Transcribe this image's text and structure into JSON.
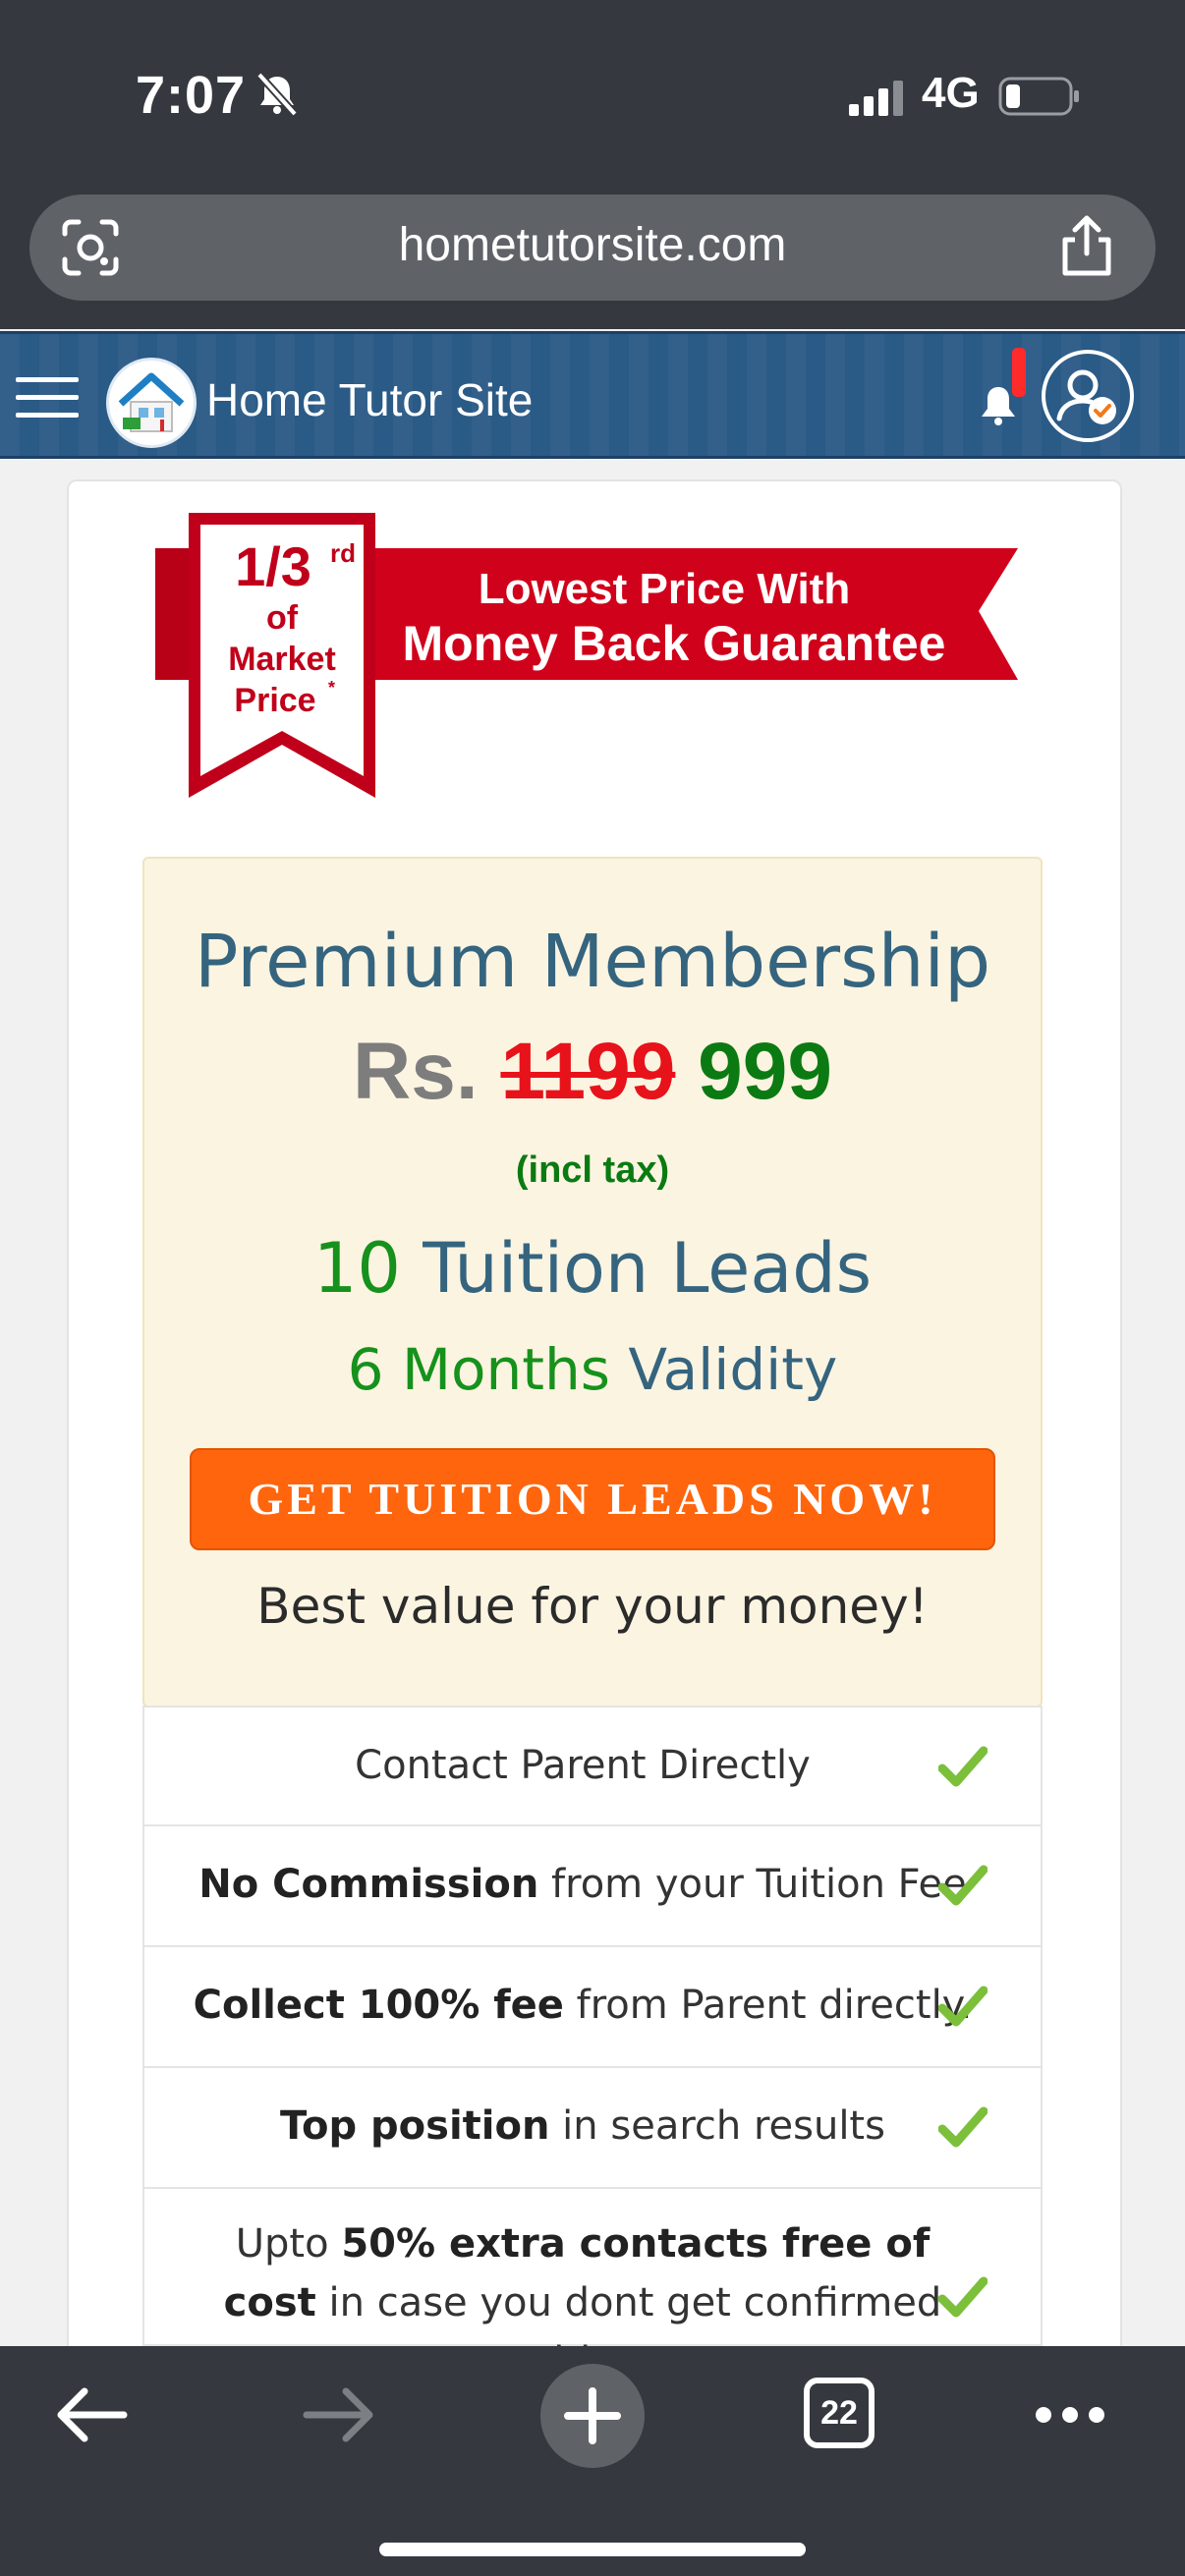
{
  "status_bar": {
    "time": "7:07",
    "network": "4G"
  },
  "browser": {
    "url": "hometutorsite.com",
    "tab_count": "22"
  },
  "header": {
    "site_name": "Home Tutor Site"
  },
  "banner": {
    "ribbon_fraction": "1/3",
    "ribbon_superscript": "rd",
    "ribbon_line2": "of",
    "ribbon_line3": "Market",
    "ribbon_line4": "Price",
    "ribbon_mark": "*",
    "line1": "Lowest Price With",
    "line2": "Money Back Guarantee"
  },
  "pricing": {
    "title": "Premium Membership",
    "currency": "Rs.",
    "old_price": "1199",
    "new_price": "999",
    "tax_note": "(incl tax)",
    "leads_count": "10",
    "leads_label": "Tuition Leads",
    "validity_count": "6 Months",
    "validity_label": "Validity",
    "cta": "GET TUITION LEADS NOW!",
    "value_note": "Best value for your money!"
  },
  "features": [
    {
      "bold": "",
      "text": "Contact Parent Directly"
    },
    {
      "bold": "No Commission",
      "text": " from your Tuition Fee"
    },
    {
      "bold": "Collect 100% fee",
      "text": " from Parent directly."
    },
    {
      "bold": "Top position",
      "text": " in search results"
    },
    {
      "pre": "Upto ",
      "bold": "50% extra contacts free of cost",
      "text": " in case you dont get confirmed tuition."
    }
  ],
  "colors": {
    "header_bg": "#2a5a86",
    "cta_bg": "#ff650d",
    "price_green": "#0c7a12",
    "price_red": "#e8121b",
    "check_green": "#7cbf3a",
    "banner_red": "#d0021b"
  }
}
